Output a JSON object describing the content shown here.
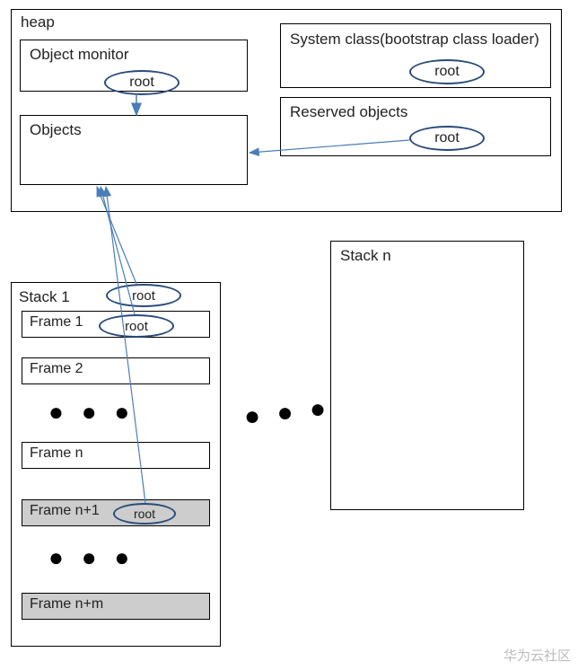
{
  "heap": {
    "title": "heap",
    "object_monitor": {
      "label": "Object monitor",
      "root": "root"
    },
    "objects": {
      "label": "Objects"
    },
    "system_class": {
      "label": "System class(bootstrap class loader)",
      "root": "root"
    },
    "reserved_objects": {
      "label": "Reserved objects",
      "root": "root"
    }
  },
  "stack1": {
    "title": "Stack 1",
    "title_root": "root",
    "frames": [
      {
        "label": "Frame 1",
        "root": "root",
        "gray": false
      },
      {
        "label": "Frame 2",
        "gray": false
      },
      {
        "label": "Frame n",
        "gray": false
      },
      {
        "label": "Frame n+1",
        "root": "root",
        "gray": true
      },
      {
        "label": "Frame n+m",
        "gray": true
      }
    ]
  },
  "stack_n": {
    "title": "Stack n"
  },
  "ellipsis": "● ● ●",
  "watermark": "华为云社区",
  "colors": {
    "arrow": "#4a7db8",
    "ellipse": "#2a4a7a"
  }
}
